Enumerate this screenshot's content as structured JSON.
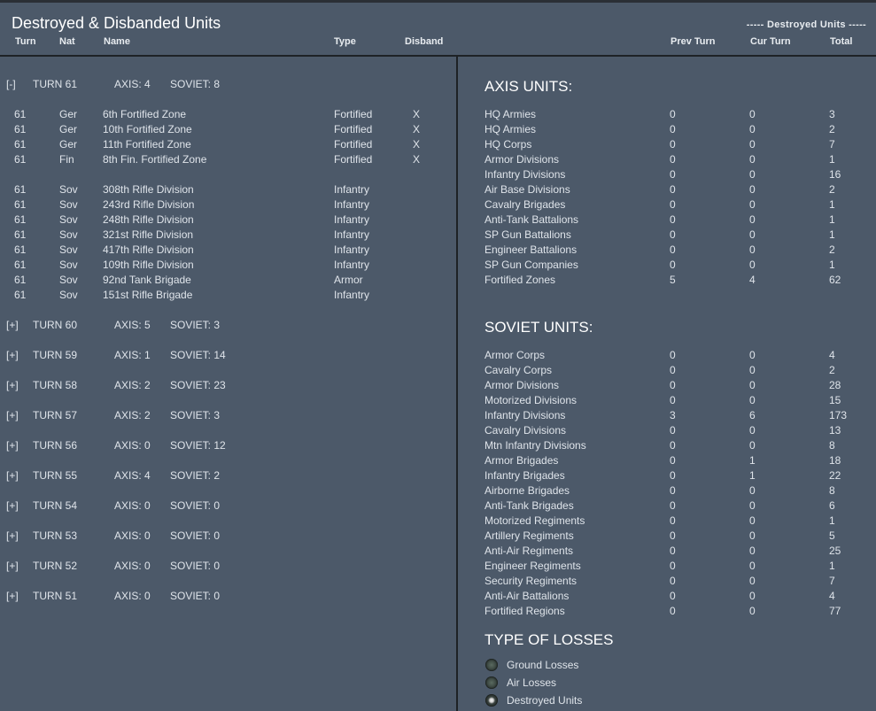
{
  "title": "Destroyed & Disbanded Units",
  "mode_label": "----- Destroyed Units -----",
  "headers": {
    "turn": "Turn",
    "nat": "Nat",
    "name": "Name",
    "type": "Type",
    "disband": "Disband",
    "prev_turn": "Prev Turn",
    "cur_turn": "Cur Turn",
    "total": "Total"
  },
  "expanded_turn": {
    "toggle": "[-]",
    "label": "TURN 61",
    "axis": "AXIS: 4",
    "soviet": "SOVIET: 8",
    "units": [
      {
        "turn": "61",
        "nat": "Ger",
        "name": "6th Fortified Zone",
        "type": "Fortified",
        "disband": "X"
      },
      {
        "turn": "61",
        "nat": "Ger",
        "name": "10th Fortified Zone",
        "type": "Fortified",
        "disband": "X"
      },
      {
        "turn": "61",
        "nat": "Ger",
        "name": "11th Fortified Zone",
        "type": "Fortified",
        "disband": "X"
      },
      {
        "turn": "61",
        "nat": "Fin",
        "name": "8th Fin. Fortified Zone",
        "type": "Fortified",
        "disband": "X"
      },
      {
        "turn": "61",
        "nat": "Sov",
        "name": "308th Rifle Division",
        "type": "Infantry",
        "disband": ""
      },
      {
        "turn": "61",
        "nat": "Sov",
        "name": "243rd Rifle Division",
        "type": "Infantry",
        "disband": ""
      },
      {
        "turn": "61",
        "nat": "Sov",
        "name": "248th Rifle Division",
        "type": "Infantry",
        "disband": ""
      },
      {
        "turn": "61",
        "nat": "Sov",
        "name": "321st Rifle Division",
        "type": "Infantry",
        "disband": ""
      },
      {
        "turn": "61",
        "nat": "Sov",
        "name": "417th Rifle Division",
        "type": "Infantry",
        "disband": ""
      },
      {
        "turn": "61",
        "nat": "Sov",
        "name": "109th Rifle Division",
        "type": "Infantry",
        "disband": ""
      },
      {
        "turn": "61",
        "nat": "Sov",
        "name": "92nd Tank Brigade",
        "type": "Armor",
        "disband": ""
      },
      {
        "turn": "61",
        "nat": "Sov",
        "name": "151st Rifle Brigade",
        "type": "Infantry",
        "disband": ""
      }
    ]
  },
  "collapsed_turns": [
    {
      "toggle": "[+]",
      "label": "TURN 60",
      "axis": "AXIS: 5",
      "soviet": "SOVIET: 3"
    },
    {
      "toggle": "[+]",
      "label": "TURN 59",
      "axis": "AXIS: 1",
      "soviet": "SOVIET: 14"
    },
    {
      "toggle": "[+]",
      "label": "TURN 58",
      "axis": "AXIS: 2",
      "soviet": "SOVIET: 23"
    },
    {
      "toggle": "[+]",
      "label": "TURN 57",
      "axis": "AXIS: 2",
      "soviet": "SOVIET: 3"
    },
    {
      "toggle": "[+]",
      "label": "TURN 56",
      "axis": "AXIS: 0",
      "soviet": "SOVIET: 12"
    },
    {
      "toggle": "[+]",
      "label": "TURN 55",
      "axis": "AXIS: 4",
      "soviet": "SOVIET: 2"
    },
    {
      "toggle": "[+]",
      "label": "TURN 54",
      "axis": "AXIS: 0",
      "soviet": "SOVIET: 0"
    },
    {
      "toggle": "[+]",
      "label": "TURN 53",
      "axis": "AXIS: 0",
      "soviet": "SOVIET: 0"
    },
    {
      "toggle": "[+]",
      "label": "TURN 52",
      "axis": "AXIS: 0",
      "soviet": "SOVIET: 0"
    },
    {
      "toggle": "[+]",
      "label": "TURN 51",
      "axis": "AXIS: 0",
      "soviet": "SOVIET: 0"
    }
  ],
  "axis_units": {
    "heading": "AXIS UNITS:",
    "rows": [
      {
        "name": "HQ Armies",
        "prev": "0",
        "cur": "0",
        "total": "3"
      },
      {
        "name": "HQ Armies",
        "prev": "0",
        "cur": "0",
        "total": "2"
      },
      {
        "name": "HQ Corps",
        "prev": "0",
        "cur": "0",
        "total": "7"
      },
      {
        "name": "Armor Divisions",
        "prev": "0",
        "cur": "0",
        "total": "1"
      },
      {
        "name": "Infantry Divisions",
        "prev": "0",
        "cur": "0",
        "total": "16"
      },
      {
        "name": "Air Base Divisions",
        "prev": "0",
        "cur": "0",
        "total": "2"
      },
      {
        "name": "Cavalry Brigades",
        "prev": "0",
        "cur": "0",
        "total": "1"
      },
      {
        "name": "Anti-Tank Battalions",
        "prev": "0",
        "cur": "0",
        "total": "1"
      },
      {
        "name": "SP Gun Battalions",
        "prev": "0",
        "cur": "0",
        "total": "1"
      },
      {
        "name": "Engineer Battalions",
        "prev": "0",
        "cur": "0",
        "total": "2"
      },
      {
        "name": "SP Gun Companies",
        "prev": "0",
        "cur": "0",
        "total": "1"
      },
      {
        "name": "Fortified Zones",
        "prev": "5",
        "cur": "4",
        "total": "62"
      }
    ]
  },
  "soviet_units": {
    "heading": "SOVIET UNITS:",
    "rows": [
      {
        "name": "Armor Corps",
        "prev": "0",
        "cur": "0",
        "total": "4"
      },
      {
        "name": "Cavalry Corps",
        "prev": "0",
        "cur": "0",
        "total": "2"
      },
      {
        "name": "Armor Divisions",
        "prev": "0",
        "cur": "0",
        "total": "28"
      },
      {
        "name": "Motorized Divisions",
        "prev": "0",
        "cur": "0",
        "total": "15"
      },
      {
        "name": "Infantry Divisions",
        "prev": "3",
        "cur": "6",
        "total": "173"
      },
      {
        "name": "Cavalry Divisions",
        "prev": "0",
        "cur": "0",
        "total": "13"
      },
      {
        "name": "Mtn Infantry Divisions",
        "prev": "0",
        "cur": "0",
        "total": "8"
      },
      {
        "name": "Armor Brigades",
        "prev": "0",
        "cur": "1",
        "total": "18"
      },
      {
        "name": "Infantry Brigades",
        "prev": "0",
        "cur": "1",
        "total": "22"
      },
      {
        "name": "Airborne Brigades",
        "prev": "0",
        "cur": "0",
        "total": "8"
      },
      {
        "name": "Anti-Tank Brigades",
        "prev": "0",
        "cur": "0",
        "total": "6"
      },
      {
        "name": "Motorized Regiments",
        "prev": "0",
        "cur": "0",
        "total": "1"
      },
      {
        "name": "Artillery Regiments",
        "prev": "0",
        "cur": "0",
        "total": "5"
      },
      {
        "name": "Anti-Air Regiments",
        "prev": "0",
        "cur": "0",
        "total": "25"
      },
      {
        "name": "Engineer Regiments",
        "prev": "0",
        "cur": "0",
        "total": "1"
      },
      {
        "name": "Security Regiments",
        "prev": "0",
        "cur": "0",
        "total": "7"
      },
      {
        "name": "Anti-Air Battalions",
        "prev": "0",
        "cur": "0",
        "total": "4"
      },
      {
        "name": "Fortified Regions",
        "prev": "0",
        "cur": "0",
        "total": "77"
      }
    ]
  },
  "loss_types": {
    "heading": "TYPE OF LOSSES",
    "options": [
      {
        "label": "Ground Losses",
        "selected": false
      },
      {
        "label": "Air Losses",
        "selected": false
      },
      {
        "label": "Destroyed Units",
        "selected": true
      }
    ]
  }
}
